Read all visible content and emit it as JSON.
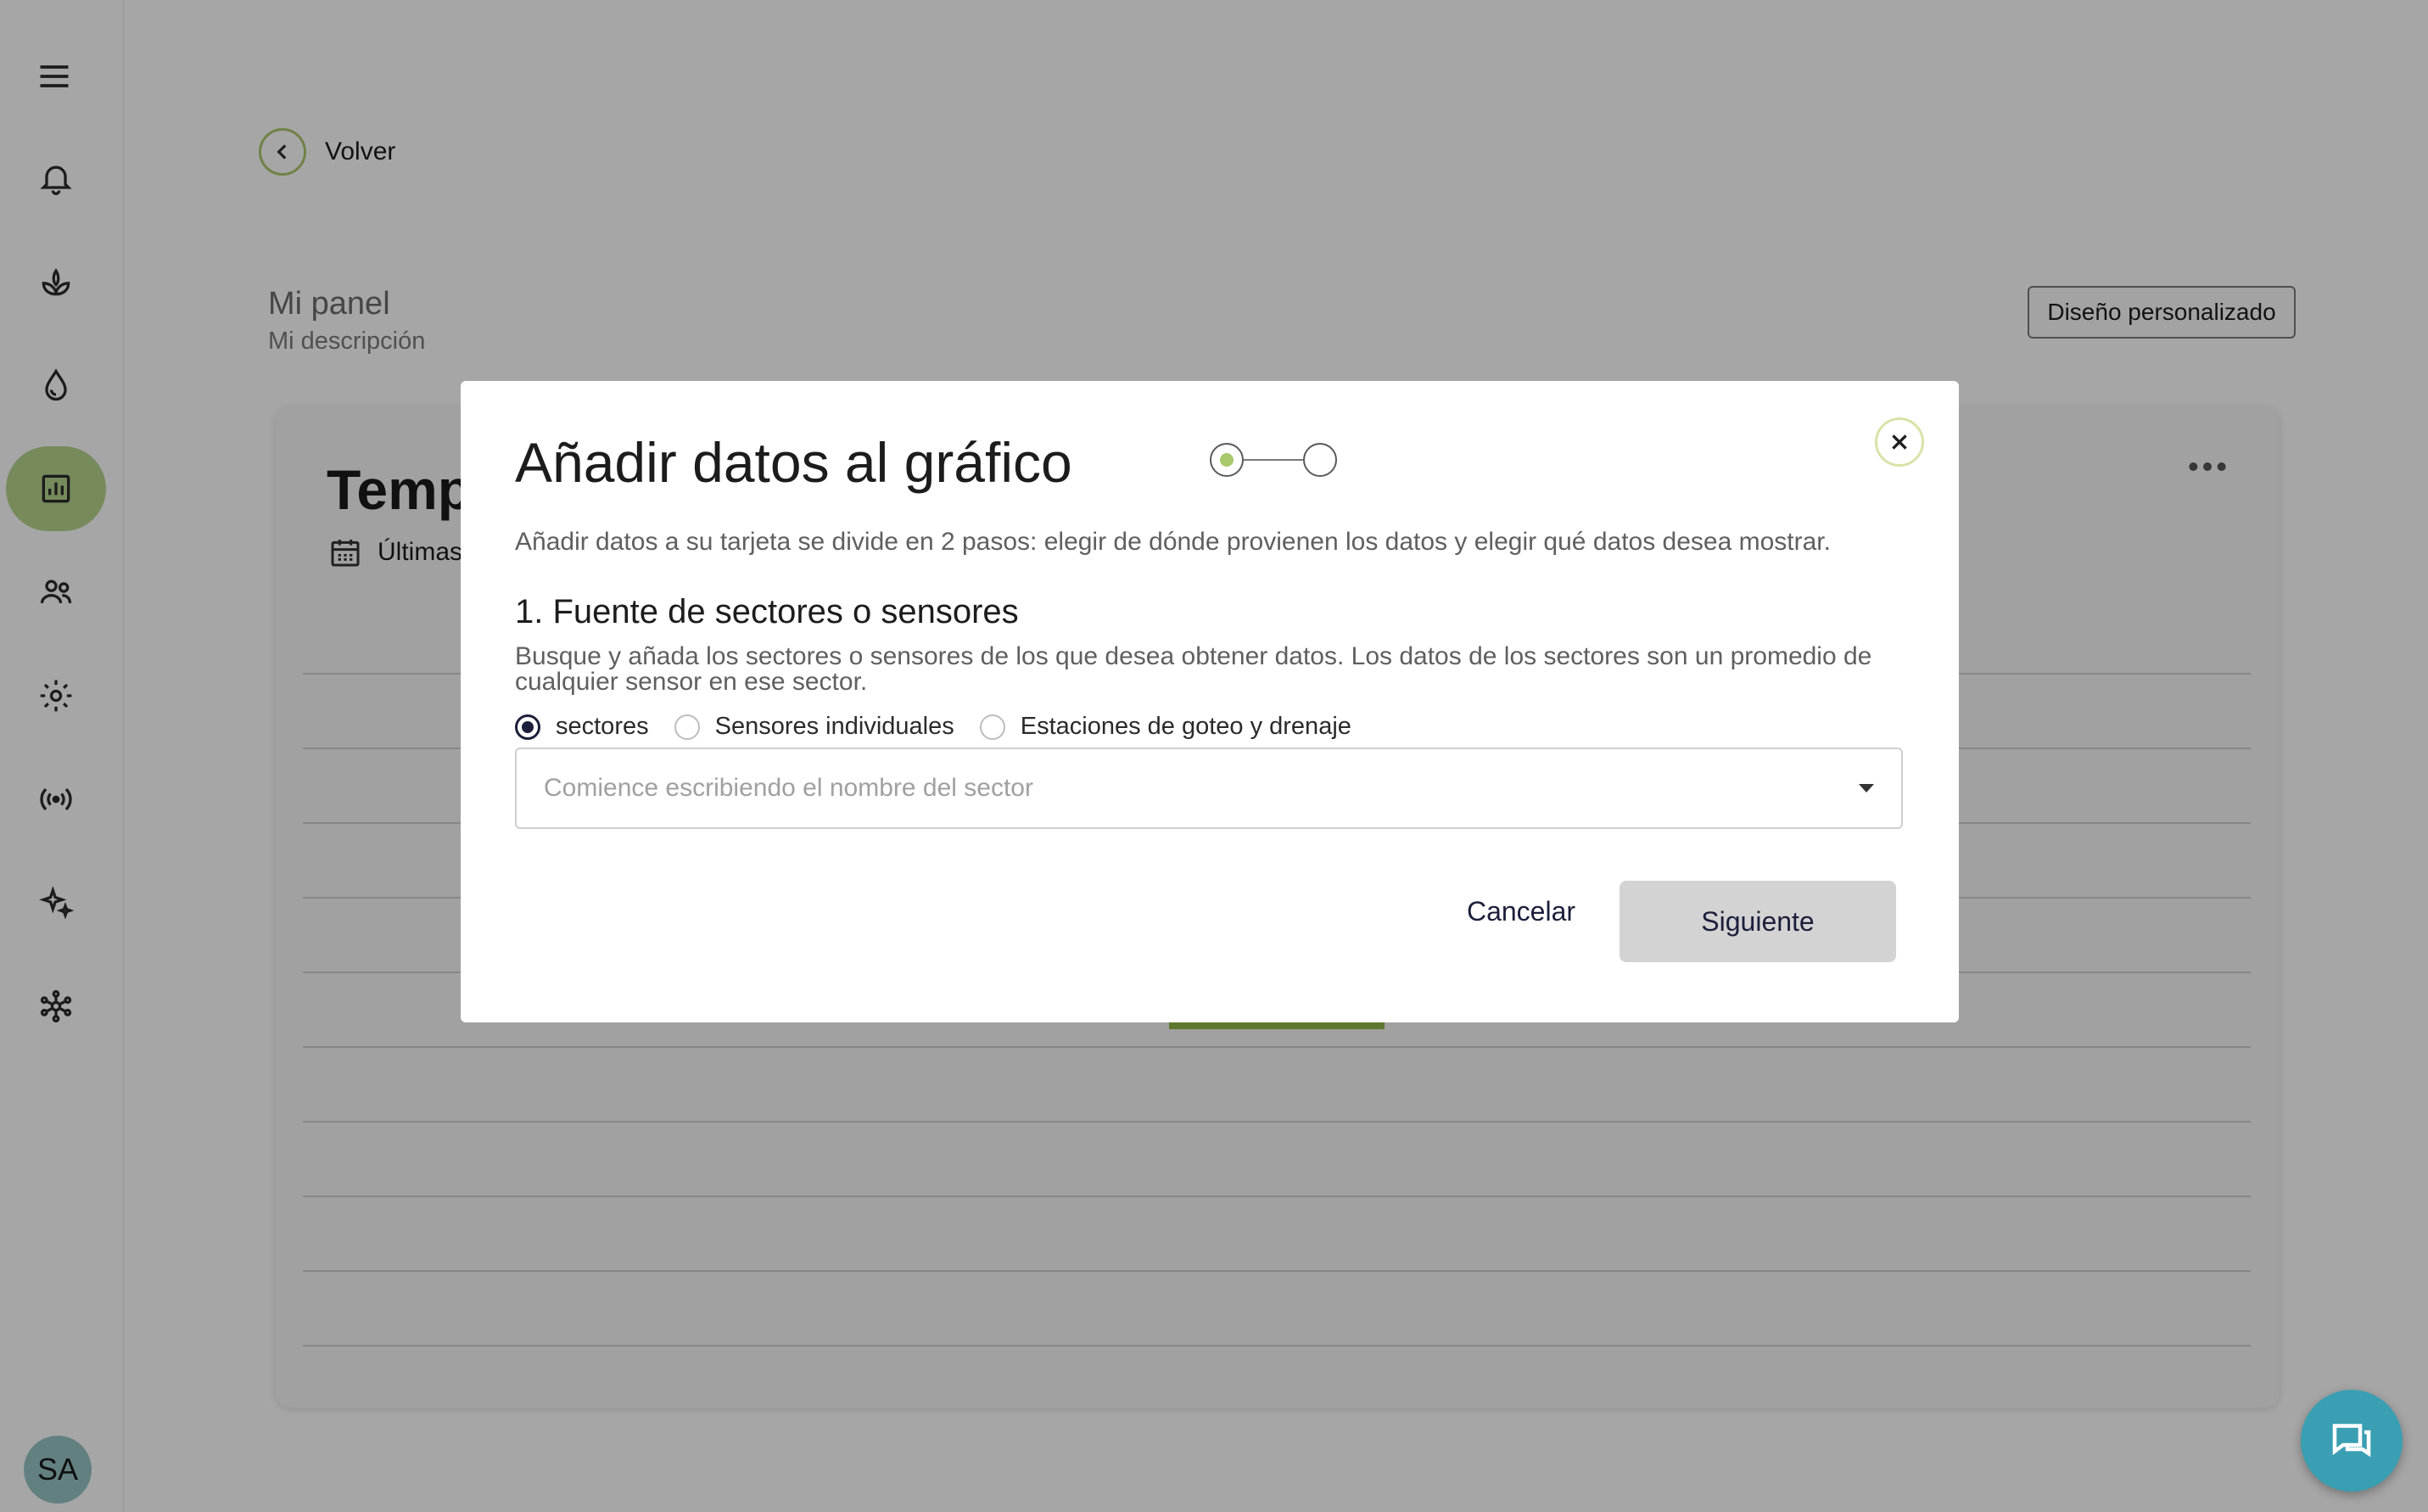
{
  "sidebar": {
    "menu_icon": "hamburger-icon",
    "items": [
      {
        "name": "notifications",
        "icon": "bell-icon"
      },
      {
        "name": "crops",
        "icon": "plant-icon"
      },
      {
        "name": "irrigation",
        "icon": "water-drop-icon"
      },
      {
        "name": "dashboards",
        "icon": "chart-icon",
        "active": true
      },
      {
        "name": "users",
        "icon": "people-icon"
      },
      {
        "name": "settings",
        "icon": "gear-icon"
      },
      {
        "name": "sensors",
        "icon": "broadcast-icon"
      },
      {
        "name": "ai",
        "icon": "sparkle-icon"
      },
      {
        "name": "network",
        "icon": "network-icon"
      }
    ],
    "avatar_initials": "SA"
  },
  "page": {
    "back_label": "Volver",
    "title": "Mi panel",
    "description": "Mi descripción",
    "custom_design_label": "Diseño personalizado"
  },
  "card": {
    "title_fragment": "Temp",
    "date_fragment": "Últimas"
  },
  "modal": {
    "title": "Añadir datos al gráfico",
    "intro": "Añadir datos a su tarjeta se divide en 2 pasos: elegir de dónde provienen los datos y elegir qué datos desea mostrar.",
    "section_title": "1. Fuente de sectores o sensores",
    "section_desc": "Busque y añada los sectores o sensores de los que desea obtener datos. Los datos de los sectores son un promedio de cualquier sensor en ese sector.",
    "radio_options": [
      {
        "label": "sectores",
        "checked": true
      },
      {
        "label": "Sensores individuales",
        "checked": false
      },
      {
        "label": "Estaciones de goteo y drenaje",
        "checked": false
      }
    ],
    "select_placeholder": "Comience escribiendo el nombre del sector",
    "cancel_label": "Cancelar",
    "next_label": "Siguiente",
    "current_step": 1,
    "total_steps": 2
  },
  "colors": {
    "accent_green": "#a9c86c",
    "active_nav": "#b6d58d",
    "chat_button": "#3a9fb2",
    "navy_text": "#1b1f3b"
  }
}
